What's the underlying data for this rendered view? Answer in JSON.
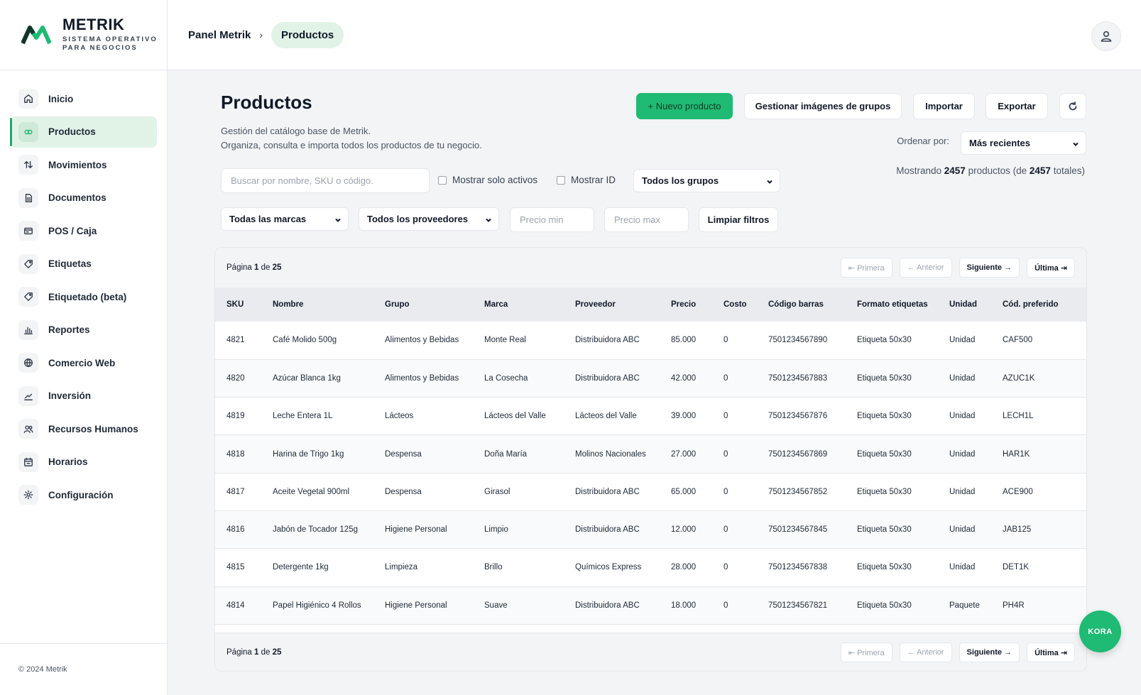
{
  "brand": {
    "name": "METRIK",
    "subtitle_1": "SISTEMA OPERATIVO",
    "subtitle_2": "PARA NEGOCIOS",
    "logo_color": "#1fba73"
  },
  "sidebar": {
    "items": [
      {
        "label": "Inicio",
        "icon": "home-icon"
      },
      {
        "label": "Productos",
        "icon": "products-icon",
        "active": true
      },
      {
        "label": "Movimientos",
        "icon": "arrows-icon"
      },
      {
        "label": "Documentos",
        "icon": "document-icon"
      },
      {
        "label": "POS / Caja",
        "icon": "register-icon"
      },
      {
        "label": "Etiquetas",
        "icon": "tag-icon"
      },
      {
        "label": "Etiquetado (beta)",
        "icon": "tag-icon"
      },
      {
        "label": "Reportes",
        "icon": "chart-icon"
      },
      {
        "label": "Comercio Web",
        "icon": "globe-icon"
      },
      {
        "label": "Inversión",
        "icon": "trend-icon"
      },
      {
        "label": "Recursos Humanos",
        "icon": "users-icon"
      },
      {
        "label": "Horarios",
        "icon": "calendar-icon"
      },
      {
        "label": "Configuración",
        "icon": "gear-icon"
      }
    ],
    "footer": "© 2024 Metrik"
  },
  "header": {
    "breadcrumb_root": "Panel Metrik",
    "breadcrumb_sep": "›",
    "breadcrumb_current": "Productos"
  },
  "page": {
    "title": "Productos",
    "desc_line1": "Gestión del catálogo base de Metrik.",
    "desc_line2": "Organiza, consulta e importa todos los productos de tu negocio."
  },
  "actions": {
    "new_product": "+ Nuevo producto",
    "manage_images": "Gestionar imágenes de grupos",
    "import": "Importar",
    "export": "Exportar"
  },
  "sort": {
    "label": "Ordenar por:",
    "value": "Más recientes"
  },
  "count": {
    "prefix": "Mostrando",
    "shown": "2457",
    "middle": "productos (de",
    "total": "2457",
    "suffix": "totales)"
  },
  "filters": {
    "search_placeholder": "Buscar por nombre, SKU o código.",
    "only_active": "Mostrar solo activos",
    "show_id": "Mostrar ID",
    "group": "Todos los grupos",
    "brand": "Todas las marcas",
    "supplier": "Todos los proveedores",
    "price_min_placeholder": "Precio min",
    "price_max_placeholder": "Precio max",
    "clear": "Limpiar filtros"
  },
  "pager": {
    "label": "Página",
    "current": "1",
    "of": "de",
    "total": "25",
    "first": "⇤ Primera",
    "prev": "← Anterior",
    "next": "Siguiente →",
    "last": "Última ⇥"
  },
  "table": {
    "columns": [
      "SKU",
      "Nombre",
      "Grupo",
      "Marca",
      "Proveedor",
      "Precio",
      "Costo",
      "Código barras",
      "Formato etiquetas",
      "Unidad",
      "Cód. preferido"
    ],
    "rows": [
      [
        "4821",
        "Café Molido 500g",
        "Alimentos y Bebidas",
        "Monte Real",
        "Distribuidora ABC",
        "85.000",
        "0",
        "7501234567890",
        "Etiqueta 50x30",
        "Unidad",
        "CAF500"
      ],
      [
        "4820",
        "Azúcar Blanca 1kg",
        "Alimentos y Bebidas",
        "La Cosecha",
        "Distribuidora ABC",
        "42.000",
        "0",
        "7501234567883",
        "Etiqueta 50x30",
        "Unidad",
        "AZUC1K"
      ],
      [
        "4819",
        "Leche Entera 1L",
        "Lácteos",
        "Lácteos del Valle",
        "Lácteos del Valle",
        "39.000",
        "0",
        "7501234567876",
        "Etiqueta 50x30",
        "Unidad",
        "LECH1L"
      ],
      [
        "4818",
        "Harina de Trigo 1kg",
        "Despensa",
        "Doña María",
        "Molinos Nacionales",
        "27.000",
        "0",
        "7501234567869",
        "Etiqueta 50x30",
        "Unidad",
        "HAR1K"
      ],
      [
        "4817",
        "Aceite Vegetal 900ml",
        "Despensa",
        "Girasol",
        "Distribuidora ABC",
        "65.000",
        "0",
        "7501234567852",
        "Etiqueta 50x30",
        "Unidad",
        "ACE900"
      ],
      [
        "4816",
        "Jabón de Tocador 125g",
        "Higiene Personal",
        "Limpio",
        "Distribuidora ABC",
        "12.000",
        "0",
        "7501234567845",
        "Etiqueta 50x30",
        "Unidad",
        "JAB125"
      ],
      [
        "4815",
        "Detergente 1kg",
        "Limpieza",
        "Brillo",
        "Químicos Express",
        "28.000",
        "0",
        "7501234567838",
        "Etiqueta 50x30",
        "Unidad",
        "DET1K"
      ],
      [
        "4814",
        "Papel Higiénico 4 Rollos",
        "Higiene Personal",
        "Suave",
        "Distribuidora ABC",
        "18.000",
        "0",
        "7501234567821",
        "Etiqueta 50x30",
        "Paquete",
        "PH4R"
      ]
    ]
  },
  "assistant": {
    "label": "KORA",
    "color": "#1fba73"
  }
}
